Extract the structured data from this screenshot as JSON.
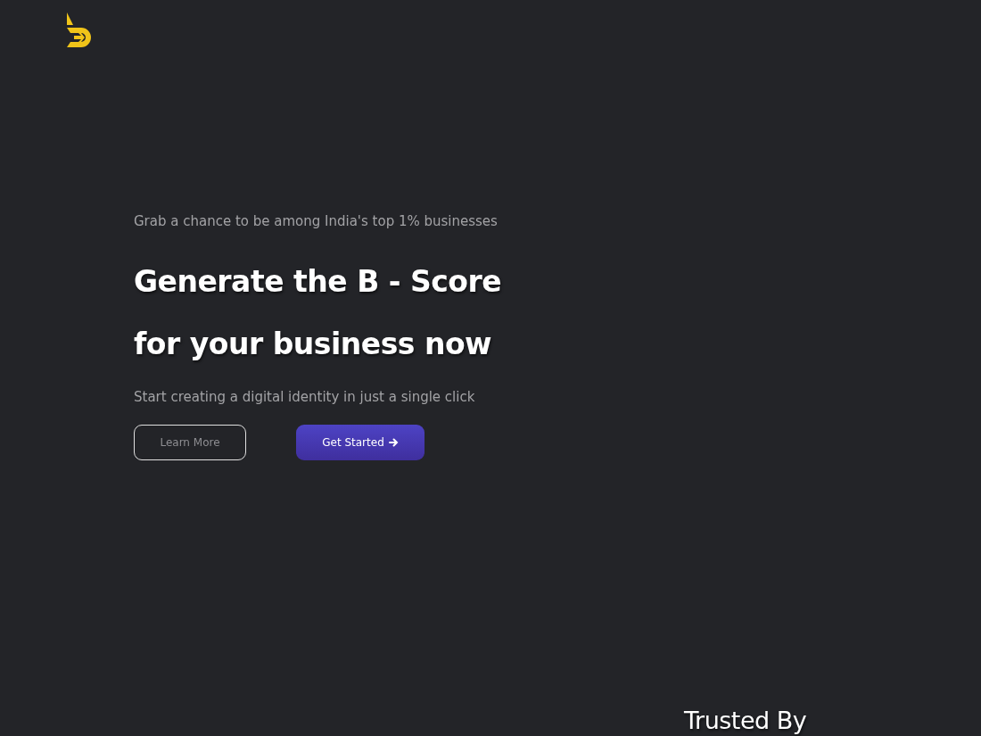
{
  "hero": {
    "tagline": "Grab a chance to be among India's top 1% businesses",
    "headline": [
      "Generate the B - Score",
      "for your business now"
    ],
    "subtitle": "Start creating a digital identity in just a single click",
    "buttons": [
      {
        "label": "Learn More",
        "kind": "outline"
      },
      {
        "label": "Get Started",
        "kind": "primary"
      }
    ]
  },
  "trusted": {
    "title": "Trusted By"
  }
}
